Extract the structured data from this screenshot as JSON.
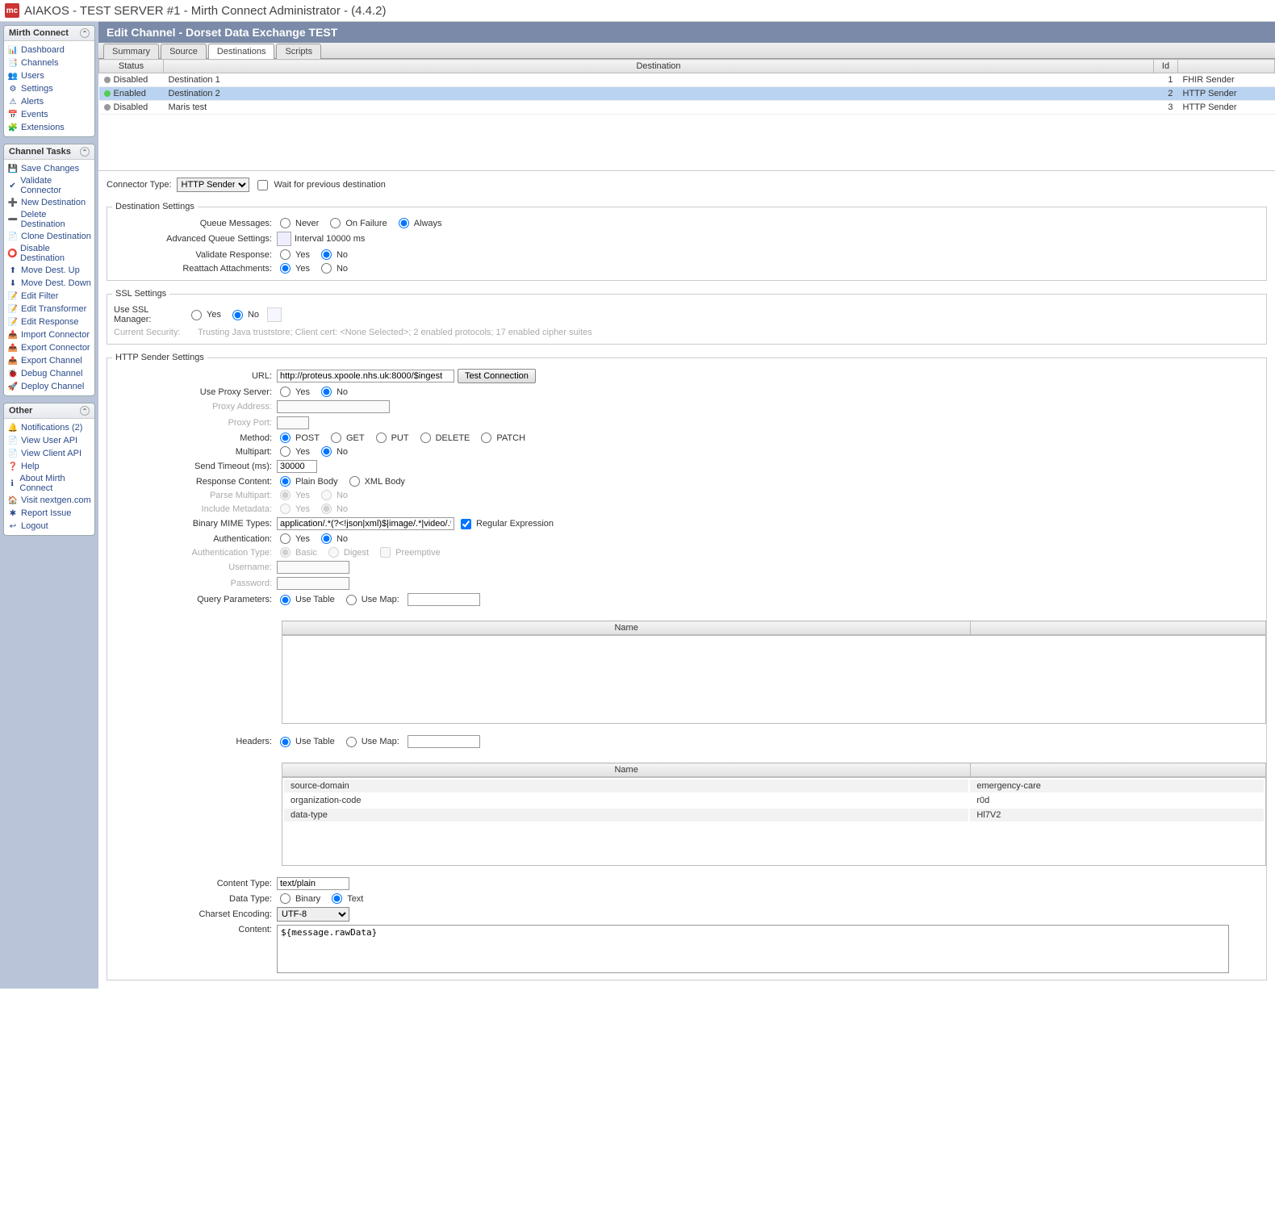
{
  "title": "AIAKOS - TEST SERVER #1 - Mirth Connect Administrator - (4.4.2)",
  "sidebar": {
    "mirth": {
      "title": "Mirth Connect",
      "items": [
        {
          "icon": "📊",
          "label": "Dashboard"
        },
        {
          "icon": "📑",
          "label": "Channels"
        },
        {
          "icon": "👥",
          "label": "Users"
        },
        {
          "icon": "⚙",
          "label": "Settings"
        },
        {
          "icon": "⚠",
          "label": "Alerts"
        },
        {
          "icon": "📅",
          "label": "Events"
        },
        {
          "icon": "🧩",
          "label": "Extensions"
        }
      ]
    },
    "tasks": {
      "title": "Channel Tasks",
      "items": [
        {
          "icon": "💾",
          "label": "Save Changes"
        },
        {
          "icon": "✔",
          "label": "Validate Connector"
        },
        {
          "icon": "➕",
          "label": "New Destination"
        },
        {
          "icon": "➖",
          "label": "Delete Destination"
        },
        {
          "icon": "📄",
          "label": "Clone Destination"
        },
        {
          "icon": "⭕",
          "label": "Disable Destination"
        },
        {
          "icon": "⬆",
          "label": "Move Dest. Up"
        },
        {
          "icon": "⬇",
          "label": "Move Dest. Down"
        },
        {
          "icon": "📝",
          "label": "Edit Filter"
        },
        {
          "icon": "📝",
          "label": "Edit Transformer"
        },
        {
          "icon": "📝",
          "label": "Edit Response"
        },
        {
          "icon": "📥",
          "label": "Import Connector"
        },
        {
          "icon": "📤",
          "label": "Export Connector"
        },
        {
          "icon": "📤",
          "label": "Export Channel"
        },
        {
          "icon": "🐞",
          "label": "Debug Channel"
        },
        {
          "icon": "🚀",
          "label": "Deploy Channel"
        }
      ]
    },
    "other": {
      "title": "Other",
      "items": [
        {
          "icon": "🔔",
          "label": "Notifications (2)"
        },
        {
          "icon": "📄",
          "label": "View User API"
        },
        {
          "icon": "📄",
          "label": "View Client API"
        },
        {
          "icon": "❓",
          "label": "Help"
        },
        {
          "icon": "ℹ",
          "label": "About Mirth Connect"
        },
        {
          "icon": "🏠",
          "label": "Visit nextgen.com"
        },
        {
          "icon": "✱",
          "label": "Report Issue"
        },
        {
          "icon": "↩",
          "label": "Logout"
        }
      ]
    }
  },
  "content": {
    "title": "Edit Channel - Dorset Data Exchange TEST",
    "tabs": [
      "Summary",
      "Source",
      "Destinations",
      "Scripts"
    ],
    "activeTab": "Destinations",
    "destTable": {
      "headers": {
        "status": "Status",
        "dest": "Destination",
        "id": "Id",
        "connector": ""
      },
      "rows": [
        {
          "status": "Disabled",
          "dest": "Destination 1",
          "id": "1",
          "connector": "FHIR Sender",
          "enabled": false
        },
        {
          "status": "Enabled",
          "dest": "Destination 2",
          "id": "2",
          "connector": "HTTP Sender",
          "enabled": true,
          "selected": true
        },
        {
          "status": "Disabled",
          "dest": "Maris test",
          "id": "3",
          "connector": "HTTP Sender",
          "enabled": false
        }
      ]
    },
    "connectorType": {
      "label": "Connector Type:",
      "value": "HTTP Sender",
      "waitLabel": "Wait for previous destination"
    },
    "destSettings": {
      "legend": "Destination Settings",
      "queue": {
        "label": "Queue Messages:",
        "never": "Never",
        "onfail": "On Failure",
        "always": "Always"
      },
      "adv": {
        "label": "Advanced Queue Settings:",
        "text": "Interval 10000 ms"
      },
      "validate": {
        "label": "Validate Response:",
        "yes": "Yes",
        "no": "No"
      },
      "reattach": {
        "label": "Reattach Attachments:",
        "yes": "Yes",
        "no": "No"
      }
    },
    "ssl": {
      "legend": "SSL Settings",
      "mgr": {
        "label": "Use SSL Manager:",
        "yes": "Yes",
        "no": "No"
      },
      "security": {
        "label": "Current Security:",
        "text": "Trusting Java truststore; Client cert: <None Selected>; 2 enabled protocols; 17 enabled cipher suites"
      }
    },
    "http": {
      "legend": "HTTP Sender Settings",
      "url": {
        "label": "URL:",
        "value": "http://proteus.xpoole.nhs.uk:8000/$ingest",
        "btn": "Test Connection"
      },
      "proxy": {
        "label": "Use Proxy Server:",
        "yes": "Yes",
        "no": "No"
      },
      "proxyAddr": {
        "label": "Proxy Address:"
      },
      "proxyPort": {
        "label": "Proxy Port:"
      },
      "method": {
        "label": "Method:",
        "post": "POST",
        "get": "GET",
        "put": "PUT",
        "delete": "DELETE",
        "patch": "PATCH"
      },
      "multipart": {
        "label": "Multipart:",
        "yes": "Yes",
        "no": "No"
      },
      "timeout": {
        "label": "Send Timeout (ms):",
        "value": "30000"
      },
      "respContent": {
        "label": "Response Content:",
        "plain": "Plain Body",
        "xml": "XML Body"
      },
      "parseMulti": {
        "label": "Parse Multipart:",
        "yes": "Yes",
        "no": "No"
      },
      "inclMeta": {
        "label": "Include Metadata:",
        "yes": "Yes",
        "no": "No"
      },
      "binMime": {
        "label": "Binary MIME Types:",
        "value": "application/.*(?<!json|xml)$|image/.*|video/.*|audio/.*",
        "regex": "Regular Expression"
      },
      "auth": {
        "label": "Authentication:",
        "yes": "Yes",
        "no": "No"
      },
      "authType": {
        "label": "Authentication Type:",
        "basic": "Basic",
        "digest": "Digest",
        "preempt": "Preemptive"
      },
      "username": {
        "label": "Username:"
      },
      "password": {
        "label": "Password:"
      },
      "queryParams": {
        "label": "Query Parameters:",
        "table": "Use Table",
        "map": "Use Map:"
      },
      "queryTable": {
        "name": "Name"
      },
      "headers": {
        "label": "Headers:",
        "table": "Use Table",
        "map": "Use Map:"
      },
      "headersTable": {
        "name": "Name",
        "rows": [
          {
            "name": "source-domain",
            "value": "emergency-care"
          },
          {
            "name": "organization-code",
            "value": "r0d"
          },
          {
            "name": "data-type",
            "value": "Hl7V2"
          }
        ]
      },
      "contentType": {
        "label": "Content Type:",
        "value": "text/plain"
      },
      "dataType": {
        "label": "Data Type:",
        "binary": "Binary",
        "text": "Text"
      },
      "charset": {
        "label": "Charset Encoding:",
        "value": "UTF-8"
      },
      "content": {
        "label": "Content:",
        "value": "${message.rawData}"
      }
    }
  }
}
